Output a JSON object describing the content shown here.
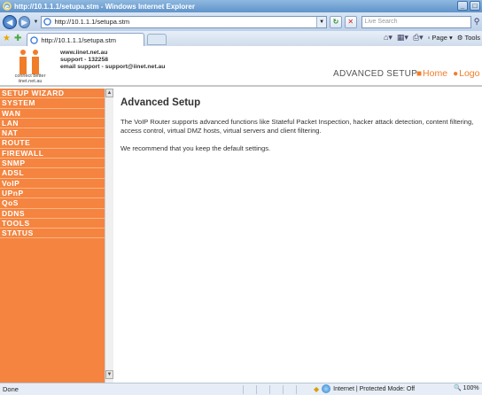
{
  "window": {
    "title": "http://10.1.1.1/setupa.stm - Windows Internet Explorer",
    "controls": [
      "_",
      "□"
    ]
  },
  "address_bar": {
    "url": "http://10.1.1.1/setupa.stm",
    "search_placeholder": "Live Search"
  },
  "tab": {
    "label": "http://10.1.1.1/setupa.stm"
  },
  "command_bar": {
    "page_label": "Page",
    "tools_label": "Tools"
  },
  "header": {
    "contact_lines": [
      "www.iinet.net.au",
      "support - 132258",
      "email support - support@iinet.net.au"
    ],
    "tagline": "connect better",
    "tagline_url": "iinet.net.au",
    "title": "ADVANCED SETUP",
    "links": [
      "Home",
      "Logo"
    ]
  },
  "sidebar": {
    "items": [
      "SETUP WIZARD",
      "SYSTEM",
      "WAN",
      "LAN",
      "NAT",
      "ROUTE",
      "FIREWALL",
      "SNMP",
      "ADSL",
      "VoIP",
      "UPnP",
      "QoS",
      "DDNS",
      "TOOLS",
      "STATUS"
    ]
  },
  "main": {
    "heading": "Advanced Setup",
    "paragraph1": "The VoIP Router supports advanced functions like Stateful Packet Inspection, hacker attack detection, content filtering, access control, virtual DMZ hosts, virtual servers and client filtering.",
    "paragraph2": "We recommend that you keep the default settings."
  },
  "status_bar": {
    "left": "Done",
    "zone": "Internet | Protected Mode: Off",
    "zoom": "100%"
  },
  "colors": {
    "sidebar": "#f4843f",
    "accent": "#f07d2a",
    "titlebar": "#5f93c9"
  }
}
